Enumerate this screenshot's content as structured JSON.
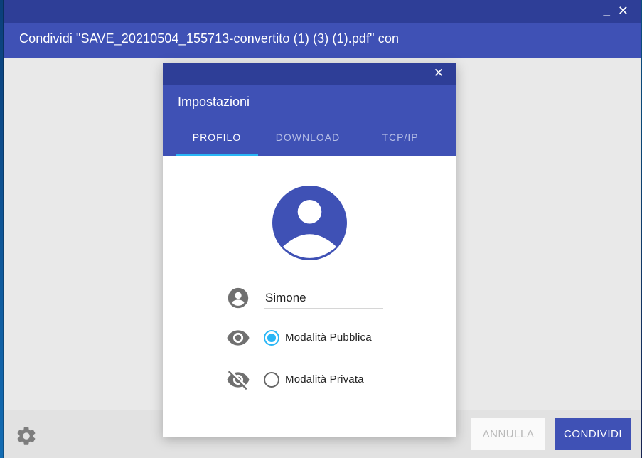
{
  "window": {
    "title": "Condividi \"SAVE_20210504_155713-convertito (1) (3) (1).pdf\" con",
    "minimize_glyph": "_",
    "close_glyph": "✕"
  },
  "dialog": {
    "title": "Impostazioni",
    "close_glyph": "✕",
    "tabs": [
      {
        "label": "PROFILO",
        "active": true
      },
      {
        "label": "DOWNLOAD",
        "active": false
      },
      {
        "label": "TCP/IP",
        "active": false
      }
    ],
    "profile": {
      "name_value": "Simone",
      "options": [
        {
          "label": "Modalità Pubblica",
          "selected": true,
          "icon": "eye-icon"
        },
        {
          "label": "Modalità Privata",
          "selected": false,
          "icon": "eye-off-icon"
        }
      ]
    }
  },
  "footer": {
    "cancel_label": "ANNULLA",
    "share_label": "CONDIVIDI"
  },
  "colors": {
    "primary": "#3f51b5",
    "primary_dark": "#2e3e97",
    "accent": "#29b6f6"
  }
}
